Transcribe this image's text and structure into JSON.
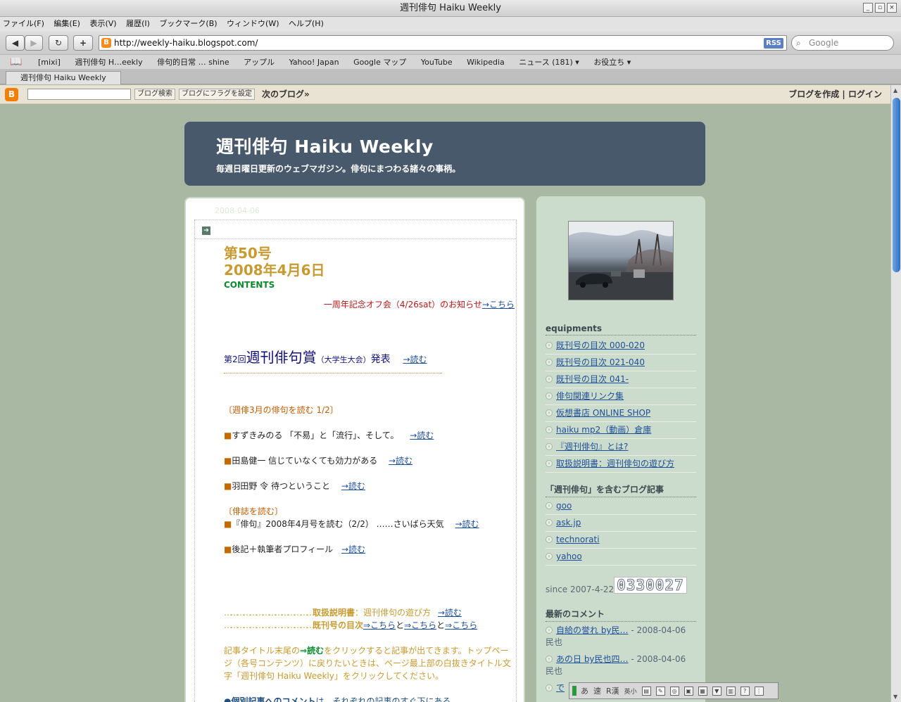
{
  "window": {
    "title": "週刊俳句  Haiku Weekly"
  },
  "menu": [
    "ファイル(F)",
    "編集(E)",
    "表示(V)",
    "履歴(I)",
    "ブックマーク(B)",
    "ウィンドウ(W)",
    "ヘルプ(H)"
  ],
  "toolbar": {
    "back": "◀",
    "forward": "▶",
    "reload": "↻",
    "add": "+",
    "url": "http://weekly-haiku.blogspot.com/",
    "rss": "RSS",
    "search_placeholder": "Google"
  },
  "bookmarks": [
    "[mixi]",
    "週刊俳句  H…eekly",
    "俳句的日常  … shine",
    "アップル",
    "Yahoo! Japan",
    "Google マップ",
    "YouTube",
    "Wikipedia",
    "ニュース (181) ▾",
    "お役立ち ▾"
  ],
  "tab": {
    "label": "週刊俳句  Haiku Weekly"
  },
  "blogger": {
    "logo": "B",
    "search_btn": "ブログ検索",
    "flag_btn": "ブログにフラグを設定",
    "next": "次のブログ»",
    "create": "ブログを作成",
    "sep": "|",
    "login": "ログイン"
  },
  "header": {
    "title": "週刊俳句  Haiku Weekly",
    "desc": "毎週日曜日更新のウェブマガジン。俳句にまつわる諸々の事柄。"
  },
  "post": {
    "date": "2008-04-06",
    "issue": "第50号",
    "issue_date": "2008年4月6日",
    "contents": "CONTENTS",
    "offkai_text": "一周年記念オフ会（4/26sat）のお知らせ",
    "offkai_link": "→こちら",
    "award_pre": "第2回",
    "award_main": "週刊俳句賞",
    "award_sub": "（大学生大会）",
    "award_post": "発表",
    "award_link": "→読む",
    "section1": "〔週俳3月の俳句を読む  1/2〕",
    "items": [
      {
        "mark": "■",
        "text": "すずきみのる 「不易」と「流行」、そして。",
        "link": "→読む"
      },
      {
        "mark": "■",
        "text": "田島健一   信じていなくても効力がある",
        "link": "→読む"
      },
      {
        "mark": "■",
        "text": "羽田野 令   待つということ",
        "link": "→読む"
      }
    ],
    "section2": "〔俳誌を読む〕",
    "item4": {
      "mark": "■",
      "text": "『俳句』2008年4月号を読む（2/2） ……さいばら天気",
      "link": "→読む"
    },
    "item5": {
      "mark": "■",
      "text": "後記＋執筆者プロフィール",
      "link": "→読む"
    },
    "manual_dots": "……………………………………",
    "manual_label": "取扱説明書",
    "manual_rest": "：週刊俳句の遊び方",
    "manual_link": "→読む",
    "back_dots": "……………………………………",
    "back_label": "既刊号の目次",
    "back_link1": "⇒こちら",
    "back_to": "と",
    "back_link2": "⇒こちら",
    "back_link3": "⇒こちら",
    "note_pre": "記事タイトル末尾の",
    "note_em": "⇒読む",
    "note_rest": "をクリックすると記事が出てきます。トップページ（各号コンテンツ）に戻りたいときは、ページ最上部の白抜きタイトル文字「週刊俳句 Haiku Weekly」をクリックしてください。",
    "note2_em": "●個別記事へのコメント",
    "note2_rest": "は、それぞれの記事のすぐ下にある"
  },
  "sidebar": {
    "equipments_title": "equipments",
    "equipments": [
      "既刊号の目次 000-020",
      "既刊号の目次 021-040",
      "既刊号の目次 041-",
      "俳句関連リンク集",
      "仮想書店 ONLINE SHOP",
      "haiku mp2（動画）倉庫",
      "『週刊俳句』とは?",
      "取扱説明書：週刊俳句の遊び方"
    ],
    "blogs_title": "「週刊俳句」を含むブログ記事",
    "blogs": [
      "goo",
      "ask.jp",
      "technorati",
      "yahoo"
    ],
    "since": "since 2007-4-22",
    "counter": "0330027",
    "comments_title": "最新のコメント",
    "comments": [
      {
        "link": "自給の誉れ  by民…",
        "meta": " - 2008-04-06 民也"
      },
      {
        "link": "あの日  by民也四…",
        "meta": " - 2008-04-06 民也"
      },
      {
        "link": "で",
        "meta": ""
      }
    ]
  },
  "ime": [
    "あ",
    "速",
    "R漢",
    "英小"
  ]
}
